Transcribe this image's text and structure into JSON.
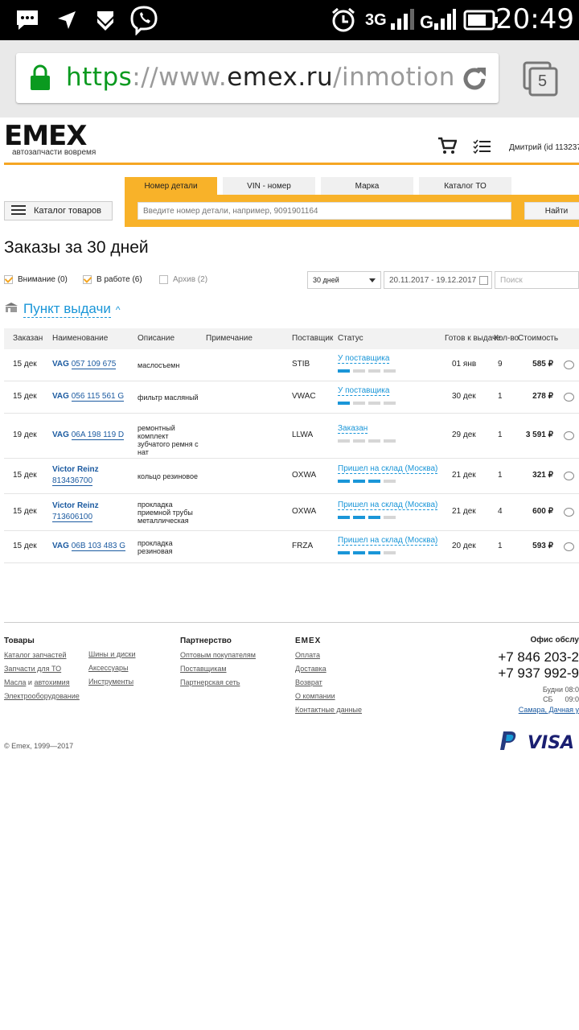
{
  "status_bar": {
    "time": "20:49",
    "network": "3G",
    "tabs_count": "5"
  },
  "browser": {
    "url_scheme": "https",
    "url_sep": "://",
    "url_host_prefix": "www.",
    "url_host_domain": "emex.ru",
    "url_path": "/inmotion",
    "tabs_count": "5"
  },
  "header": {
    "logo_text": "EMEX",
    "logo_tagline": "автозапчасти вовремя",
    "user_label": "Дмитрий  (id 113237"
  },
  "search": {
    "tabs": [
      "Номер детали",
      "VIN - номер",
      "Марка",
      "Каталог ТО"
    ],
    "active_tab": "Номер детали",
    "placeholder": "Введите номер детали, например, 9091901164",
    "button": "Найти"
  },
  "catalog_button": "Каталог товаров",
  "page_title": "Заказы за 30 дней",
  "filters": {
    "attention": "Внимание (0)",
    "in_work": "В работе (6)",
    "archive": "Архив (2)",
    "period": "30 дней",
    "date_range": "20.11.2017 - 19.12.2017",
    "search_placeholder": "Поиск"
  },
  "pickup_label": "Пункт выдачи",
  "table": {
    "columns": {
      "ordered": "Заказан",
      "name": "Наименование",
      "description": "Описание",
      "note": "Примечание",
      "supplier": "Поставщик",
      "status": "Статус",
      "ready": "Готов к выдаче",
      "qty": "Кол-во",
      "cost": "Стоимость"
    },
    "rows": [
      {
        "ordered": "15 дек",
        "brand": "VAG",
        "code": "057 109 675",
        "description": "маслосъемн",
        "supplier": "STIB",
        "status": "У поставщика",
        "progress": 1,
        "ready": "01 янв",
        "qty": "9",
        "cost": "585 ₽"
      },
      {
        "ordered": "15 дек",
        "brand": "VAG",
        "code": "056 115 561 G",
        "description": "фильтр масляный",
        "supplier": "VWAC",
        "status": "У поставщика",
        "progress": 1,
        "ready": "30 дек",
        "qty": "1",
        "cost": "278 ₽"
      },
      {
        "ordered": "19 дек",
        "brand": "VAG",
        "code": "06A 198 119 D",
        "description": "ремонтный комплект зубчатого ремня с нат",
        "supplier": "LLWA",
        "status": "Заказан",
        "progress": 0,
        "ready": "29 дек",
        "qty": "1",
        "cost": "3 591 ₽"
      },
      {
        "ordered": "15 дек",
        "brand": "Victor Reinz",
        "code": "813436700",
        "description": "кольцо резиновое",
        "supplier": "OXWA",
        "status": "Пришел на склад (Москва)",
        "progress": 3,
        "ready": "21 дек",
        "qty": "1",
        "cost": "321 ₽"
      },
      {
        "ordered": "15 дек",
        "brand": "Victor Reinz",
        "code": "713606100",
        "description": "прокладка приемной трубы металлическая",
        "supplier": "OXWA",
        "status": "Пришел на склад (Москва)",
        "progress": 3,
        "ready": "21 дек",
        "qty": "4",
        "cost": "600 ₽"
      },
      {
        "ordered": "15 дек",
        "brand": "VAG",
        "code": "06B 103 483 G",
        "description": "прокладка резиновая",
        "supplier": "FRZA",
        "status": "Пришел на склад (Москва)",
        "progress": 3,
        "ready": "20 дек",
        "qty": "1",
        "cost": "593 ₽"
      }
    ]
  },
  "footer": {
    "goods": {
      "title": "Товары",
      "col1": [
        "Каталог запчастей",
        "Запчасти для ТО"
      ],
      "oils": "Масла",
      "and": "и",
      "chem": "автохимия",
      "electro": "Электрооборудование",
      "col2": [
        "Шины и диски",
        "Аксессуары",
        "Инструменты"
      ]
    },
    "partners": {
      "title": "Партнерство",
      "links": [
        "Оптовым покупателям",
        "Поставщикам",
        "Партнерская сеть"
      ]
    },
    "emex": {
      "title": "EMEX",
      "links": [
        "Оплата",
        "Доставка",
        "Возврат",
        "О компании",
        "Контактные данные"
      ]
    },
    "office": {
      "title": "Офис обслу",
      "phone1": "+7 846 203-2",
      "phone2": "+7 937 992-9",
      "weekdays": "Будни 08:0",
      "saturday": "СБ      09:0",
      "address": "Самара, Дачная у"
    },
    "copyright": "© Emex, 1999—2017",
    "pay_visa": "VISA"
  },
  "colors": {
    "accent": "#f8b229",
    "link": "#1a96d8",
    "brand_link": "#1b5aa0",
    "url_green": "#0a9a1f"
  }
}
